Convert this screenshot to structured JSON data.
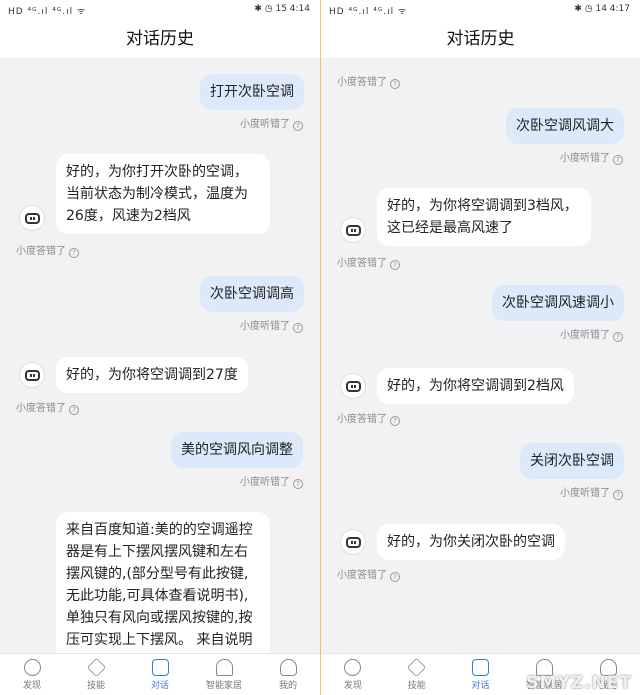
{
  "left": {
    "status": {
      "left": "HD ⁴ᴳ.ıl ⁴ᴳ.ıl ᯤ",
      "right": "✱ ◷ 15 4:14"
    },
    "title": "对话历史",
    "messages": {
      "u1": "打开次卧空调",
      "b1": "好的，为你打开次卧的空调，当前状态为制冷模式，温度为26度，风速为2档风",
      "u2": "次卧空调调高",
      "b2": "好的，为你将空调调到27度",
      "u3": "美的空调风向调整",
      "b3": "来自百度知道:美的的空调遥控器是有上下摆风摆风键和左右摆风键的,(部分型号有此按键,无此功能,可具体查看说明书),单独只有风向或摆风按键的,按压可实现上下摆风。 来自说明"
    }
  },
  "right": {
    "status": {
      "left": "HD ⁴ᴳ.ıl ⁴ᴳ.ıl ᯤ",
      "right": "✱ ◷ 14 4:17"
    },
    "title": "对话历史",
    "messages": {
      "u1": "次卧空调风调大",
      "b1": "好的，为你将空调调到3档风，这已经是最高风速了",
      "u2": "次卧空调风速调小",
      "b2": "好的，为你将空调调到2档风",
      "u3": "关闭次卧空调",
      "b3": "好的，为你关闭次卧的空调"
    }
  },
  "feedback": {
    "user": "小度听错了",
    "bot": "小度答错了",
    "q": "?"
  },
  "tabs": [
    "发现",
    "技能",
    "对话",
    "智能家居",
    "我的"
  ],
  "watermark": "SMYZ.NET"
}
